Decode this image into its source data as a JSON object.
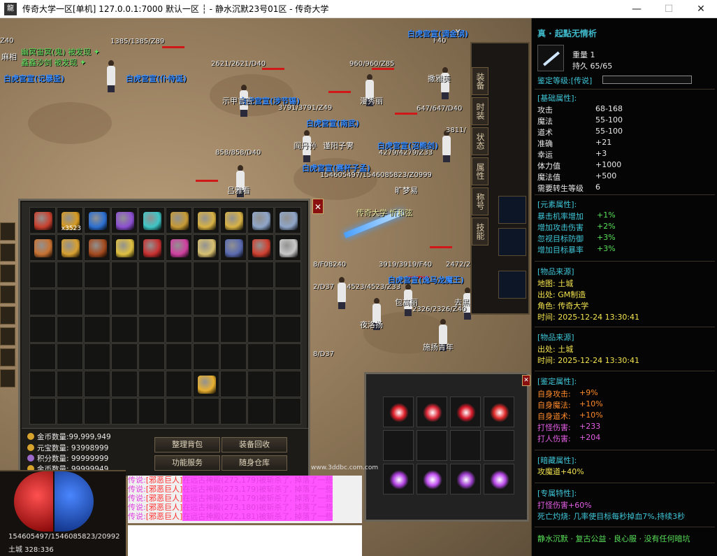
{
  "window": {
    "app_icon": "龍",
    "title": "传奇大学一区[单机] 127.0.0.1:7000  默认一区 ┆ - 静水沉默23号01区 - 传奇大学",
    "minimize": "—",
    "maximize": "☐",
    "close": "✕"
  },
  "scene": {
    "hp_labels": [
      "1385/1385/Z89",
      "2621/2621/D40",
      "960/960/Z85",
      "3791/3791/Z49",
      "858/858/D40",
      "4279/4279/Z33",
      "647/647/D40",
      "154605497/1546085823/Z0999",
      "3919/3919/F40",
      "2472/2472",
      "4523/4523/Z33",
      "2326/2326/Z40",
      "8/F08240",
      "8/D37",
      "F40",
      "Z40",
      "2/D37",
      "3811/"
    ],
    "guild_tags": [
      "白虎宫宣(调金钢)",
      "白虎宫宣(记暴歪)",
      "白虎宫宣(仆侍诞)",
      "白虎宫宣(涉节锡)",
      "白虎宫宣(南武)",
      "白虎宫宣(赛杯子孟)",
      "白虎宫宣(逸马龙魔王)",
      "白虎宫宣(沼熊剑)"
    ],
    "npc_names": [
      "示甲言吉",
      "漫秀丽",
      "撒雅美",
      "阎丹孙",
      "谨阳子霁",
      "吕雅看",
      "旷梦易",
      "包高丽",
      "去黑龙魔",
      "夜洛扬",
      "施扬青年",
      "传奇大学 忻和弦",
      "Y"
    ],
    "green_messages": [
      "幽冥宙冥(鬼) 被发现 ✦",
      "鑫鑫沙剑 被发现 ✦"
    ]
  },
  "char_panel": {
    "tabs": [
      "装备",
      "时装",
      "状态",
      "属性",
      "称号",
      "技能"
    ]
  },
  "bag": {
    "close": "✕",
    "items": [
      {
        "name": "amulet-item",
        "color": "#c8402e"
      },
      {
        "name": "scroll-item",
        "color": "#d79a20",
        "count": "x3523"
      },
      {
        "name": "blue-crystal-item",
        "color": "#2c6fd1"
      },
      {
        "name": "rainbow-gem-item",
        "color": "#8c4fd1"
      },
      {
        "name": "bracelet-item",
        "color": "#3ec6c6"
      },
      {
        "name": "helmet-item",
        "color": "#c79a34"
      },
      {
        "name": "gold-ring-item",
        "color": "#d8b244"
      },
      {
        "name": "gold-ring-item-2",
        "color": "#d8b244"
      },
      {
        "name": "silver-ring-item",
        "color": "#8fa6c9"
      },
      {
        "name": "silver-ring-item-2",
        "color": "#8fa6c9"
      },
      {
        "name": "weapon-item",
        "color": "#c87232"
      },
      {
        "name": "weapon-item-2",
        "color": "#d8a030"
      },
      {
        "name": "weapon-item-3",
        "color": "#a34a1e"
      },
      {
        "name": "weapon-item-4",
        "color": "#e0c040"
      },
      {
        "name": "blade-item",
        "color": "#c83030"
      },
      {
        "name": "wing-item",
        "color": "#d040a0"
      },
      {
        "name": "staff-item",
        "color": "#d8c070"
      },
      {
        "name": "armor-item",
        "color": "#5a6ab0"
      },
      {
        "name": "sword-item",
        "color": "#d04030"
      },
      {
        "name": "book-item",
        "color": "#c8c8c8"
      }
    ],
    "special_item_color": "#e8b030",
    "gold_count": "金币数量:99,999,949",
    "yuanbao": "元宝数量: 93998999",
    "points": "积分数量: 99999999",
    "gold_count_2": "金币数量: 99999949",
    "buttons": {
      "sort": "整理背包",
      "recycle": "装备回收",
      "service": "功能服务",
      "warehouse": "随身仓库"
    }
  },
  "gem_panel": {
    "close": "✕",
    "gems": [
      {
        "name": "red-star-gem",
        "color": "#e0202a"
      },
      {
        "name": "red-burst-gem",
        "color": "#e02a3a"
      },
      {
        "name": "red-orb-gem",
        "color": "#d81a2a"
      },
      {
        "name": "red-hex-gem",
        "color": "#e02a2a"
      },
      null,
      null,
      null,
      null,
      {
        "name": "purple-star-gem",
        "color": "#b040e0"
      },
      {
        "name": "purple-burst-gem",
        "color": "#c050f0"
      },
      {
        "name": "purple-orb-gem",
        "color": "#a040d0"
      },
      {
        "name": "purple-hex-gem",
        "color": "#b848e8"
      }
    ]
  },
  "chat": {
    "url": "www.3ddbc.com.com",
    "lines": [
      {
        "tag": "传说:",
        "sys": "[邪恶巨人]",
        "text": "在远古神殿(272,179)被斩杀了, 掉落了一些"
      },
      {
        "tag": "传说:",
        "sys": "[邪恶巨人]",
        "text": "在远古神殿(273,179)被斩杀了, 掉落了一些"
      },
      {
        "tag": "传说:",
        "sys": "[邪恶巨人]",
        "text": "在远古神殿(274,179)被斩杀了, 掉落了一些"
      },
      {
        "tag": "传说:",
        "sys": "[邪恶巨人]",
        "text": "在远古神殿(273,180)被斩杀了, 掉落了一些"
      },
      {
        "tag": "传说:",
        "sys": "[邪恶巨人]",
        "text": "在远古神殿(272,181)被斩杀了, 掉落了一些"
      }
    ]
  },
  "status": {
    "hp": "154605497/1546085823/20992",
    "map": "土城  328:336",
    "side_label": "麻相"
  },
  "tooltip": {
    "title": "真 · 起點无情析",
    "weight": "重量 1",
    "durability": "持久 65/65",
    "identify_label": "鉴定等级:",
    "identify_value": "[传说]",
    "base_header": "[基础属性]:",
    "base": [
      {
        "k": "攻击",
        "v": "68-168"
      },
      {
        "k": "魔法",
        "v": "55-100"
      },
      {
        "k": "道术",
        "v": "55-100"
      },
      {
        "k": "准确",
        "v": "+21"
      },
      {
        "k": "幸运",
        "v": "+3"
      },
      {
        "k": "体力值",
        "v": "+1000"
      },
      {
        "k": "魔法值",
        "v": "+500"
      },
      {
        "k": "需要转生等级",
        "v": "6"
      }
    ],
    "element_header": "[元素属性]:",
    "element": [
      {
        "k": "暴击机率增加",
        "v": "+1%"
      },
      {
        "k": "增加攻击伤害",
        "v": "+2%"
      },
      {
        "k": "忽视目标防御",
        "v": "+3%"
      },
      {
        "k": "增加目标暴率",
        "v": "+3%"
      }
    ],
    "source1_header": "[物品来源]",
    "source1": [
      "地图: 土城",
      "出处: GM制造",
      "角色: 传奇大学",
      "时间: 2025-12-24 13:30:41"
    ],
    "source2_header": "[物品来源]",
    "source2": [
      "出处: 土城",
      "时间: 2025-12-24 13:30:41"
    ],
    "identify_header": "[鉴定属性]:",
    "identify_attrs": [
      {
        "k": "自身攻击:",
        "v": "+9%",
        "cls": "tt-orange"
      },
      {
        "k": "自身魔法:",
        "v": "+10%",
        "cls": "tt-orange"
      },
      {
        "k": "自身道术:",
        "v": "+10%",
        "cls": "tt-orange"
      },
      {
        "k": "打怪伤害:",
        "v": "+233",
        "cls": "tt-pink"
      },
      {
        "k": "打人伤害:",
        "v": "+204",
        "cls": "tt-pink"
      }
    ],
    "hidden_header": "[暗藏属性]:",
    "hidden": "攻魔道+40%",
    "exclusive_header": "[专属特性]:",
    "exclusive_1": "打怪伤害+60%",
    "exclusive_2": "死亡灼烧: 几率使目标每秒掉血7%,持续3秒",
    "footer": "静水沉默 · 复古公益 · 良心服 · 没有任何暗坑"
  }
}
